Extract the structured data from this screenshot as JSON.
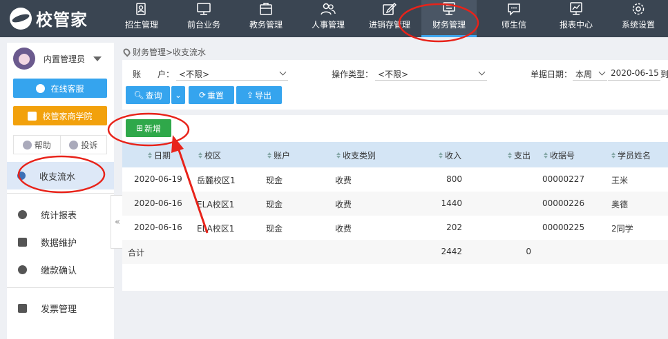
{
  "app": {
    "logo_text": "校管家"
  },
  "nav": [
    {
      "label": "招生管理",
      "icon": "enrollment-icon"
    },
    {
      "label": "前台业务",
      "icon": "monitor-icon"
    },
    {
      "label": "教务管理",
      "icon": "briefcase-icon"
    },
    {
      "label": "人事管理",
      "icon": "users-icon"
    },
    {
      "label": "进销存管理",
      "icon": "edit-icon"
    },
    {
      "label": "财务管理",
      "icon": "finance-icon",
      "active": true
    },
    {
      "label": "师生信",
      "icon": "chat-icon"
    },
    {
      "label": "报表中心",
      "icon": "chart-icon"
    },
    {
      "label": "系统设置",
      "icon": "gear-icon"
    }
  ],
  "sidebar": {
    "user": "内置管理员",
    "service_btn": "在线客服",
    "academy_btn": "校管家商学院",
    "help": "帮助",
    "complain": "投诉",
    "active_item": "收支流水",
    "items": [
      "统计报表",
      "数据维护",
      "缴款确认",
      "发票管理"
    ]
  },
  "breadcrumb": "财务管理>收支流水",
  "filters": {
    "account_label": "账　　户：",
    "account_value": "<不限>",
    "optype_label": "操作类型：",
    "optype_value": "<不限>",
    "date_label": "单据日期：",
    "date_range": "本周",
    "date_from": "2020-06-15",
    "date_to_sep": "到"
  },
  "actions": {
    "query": "查询",
    "reset": "重置",
    "export": "导出",
    "new": "新增"
  },
  "table": {
    "headers": [
      "日期",
      "校区",
      "账户",
      "收支类别",
      "收入",
      "支出",
      "收据号",
      "学员姓名"
    ],
    "rows": [
      [
        "2020-06-19",
        "岳麓校区1",
        "现金",
        "收费",
        "800",
        "",
        "00000227",
        "王米"
      ],
      [
        "2020-06-16",
        "ELA校区1",
        "现金",
        "收费",
        "1440",
        "",
        "00000226",
        "奥德"
      ],
      [
        "2020-06-16",
        "ELA校区1",
        "现金",
        "收费",
        "202",
        "",
        "00000225",
        "2同学"
      ]
    ],
    "total_label": "合计",
    "total_income": "2442",
    "total_expense": "0"
  },
  "colors": {
    "topbar": "#3a4552",
    "accent": "#35a4ee",
    "academy": "#f2a10c",
    "new_button": "#2fa84a",
    "annotation": "#e8231a"
  }
}
